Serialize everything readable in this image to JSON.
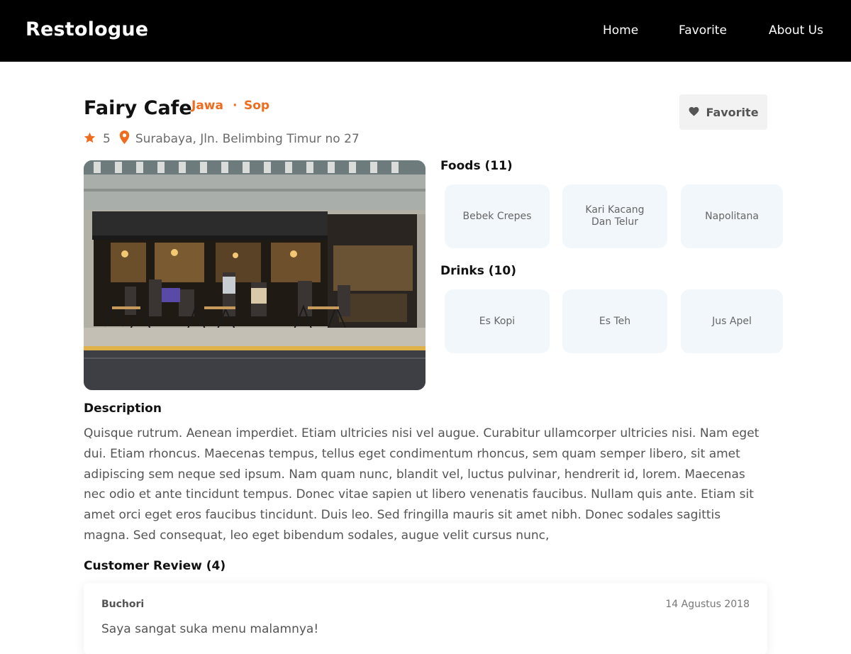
{
  "navbar": {
    "brand": "Restologue",
    "links": [
      "Home",
      "Favorite",
      "About Us"
    ]
  },
  "restaurant": {
    "name": "Fairy Cafe",
    "categories": [
      "Jawa",
      "Sop"
    ],
    "separator": "·",
    "rating": "5",
    "address": "Surabaya, Jln. Belimbing Timur no 27",
    "favorite_label": "Favorite",
    "image_alt": "Cafe storefront with outdoor seating"
  },
  "menus": {
    "foods_title": "Foods (11)",
    "foods": [
      "Bebek Crepes",
      "Kari Kacang Dan Telur",
      "Napolitana"
    ],
    "drinks_title": "Drinks (10)",
    "drinks": [
      "Es Kopi",
      "Es Teh",
      "Jus Apel"
    ]
  },
  "description": {
    "title": "Description",
    "text": "Quisque rutrum. Aenean imperdiet. Etiam ultricies nisi vel augue. Curabitur ullamcorper ultricies nisi. Nam eget dui. Etiam rhoncus. Maecenas tempus, tellus eget condimentum rhoncus, sem quam semper libero, sit amet adipiscing sem neque sed ipsum. Nam quam nunc, blandit vel, luctus pulvinar, hendrerit id, lorem. Maecenas nec odio et ante tincidunt tempus. Donec vitae sapien ut libero venenatis faucibus. Nullam quis ante. Etiam sit amet orci eget eros faucibus tincidunt. Duis leo. Sed fringilla mauris sit amet nibh. Donec sodales sagittis magna. Sed consequat, leo eget bibendum sodales, augue velit cursus nunc,"
  },
  "reviews": {
    "title": "Customer Review (4)",
    "items": [
      {
        "name": "Buchori",
        "date": "14 Agustus 2018",
        "text": "Saya sangat suka menu malamnya!"
      }
    ]
  },
  "colors": {
    "accent": "#ef6c1f",
    "navbar": "#000000",
    "menu_card": "#f1f7fb"
  },
  "icons": {
    "rating": "star-icon",
    "location": "location-pin-icon",
    "favorite": "heart-icon"
  }
}
